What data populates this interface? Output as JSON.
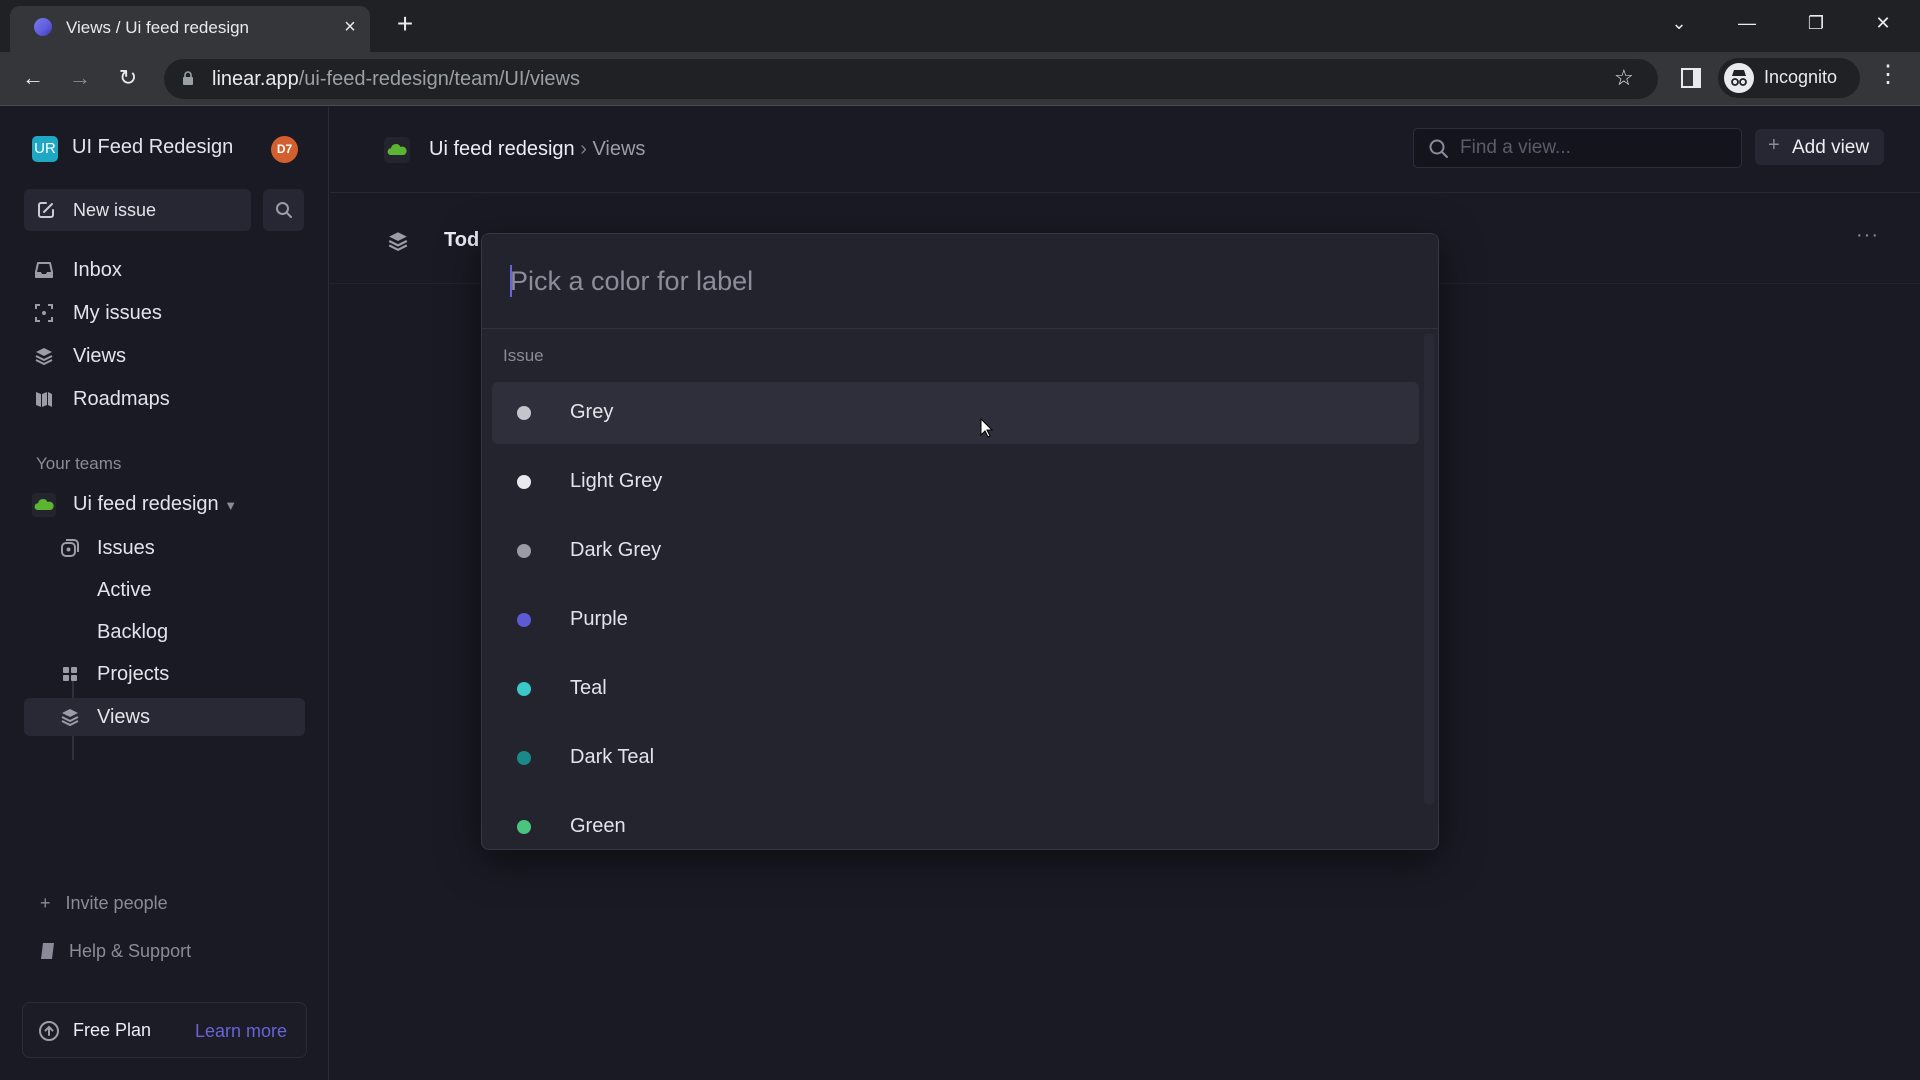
{
  "browser": {
    "tab_title": "Views / Ui feed redesign",
    "tab_close": "×",
    "new_tab": "+",
    "url_host": "linear.app",
    "url_path": "/ui-feed-redesign/team/UI/views",
    "profile_label": "Incognito",
    "window_controls": {
      "tab_search": "⌄",
      "minimize": "—",
      "maximize": "❐",
      "close": "✕"
    },
    "nav": {
      "back": "←",
      "forward": "→",
      "reload": "↻"
    },
    "star": "☆",
    "menu": "⋮"
  },
  "sidebar": {
    "workspace_initials": "UR",
    "workspace_name": "UI Feed Redesign",
    "avatar_initials": "D7",
    "new_issue_label": "New issue",
    "nav_items": [
      {
        "label": "Inbox",
        "icon": "inbox-icon"
      },
      {
        "label": "My issues",
        "icon": "my-issues-icon"
      },
      {
        "label": "Views",
        "icon": "views-icon"
      },
      {
        "label": "Roadmaps",
        "icon": "roadmaps-icon"
      }
    ],
    "teams_heading": "Your teams",
    "team": {
      "name": "Ui feed redesign",
      "caret": "▼",
      "items": [
        {
          "label": "Issues",
          "icon": "issues-icon"
        },
        {
          "label": "Active"
        },
        {
          "label": "Backlog"
        },
        {
          "label": "Projects",
          "icon": "projects-icon"
        },
        {
          "label": "Views",
          "icon": "views-icon",
          "active": true
        }
      ]
    },
    "invite_label": "Invite people",
    "invite_icon": "+",
    "help_label": "Help & Support",
    "plan_label": "Free Plan",
    "learn_more_label": "Learn more"
  },
  "header": {
    "breadcrumb_team": "Ui feed redesign",
    "breadcrumb_sep": " › ",
    "breadcrumb_page": "Views",
    "search_placeholder": "Find a view...",
    "add_view_plus": "+",
    "add_view_label": "Add view"
  },
  "view_row": {
    "name": "Tod",
    "more": "···"
  },
  "color_picker": {
    "placeholder": "Pick a color for label",
    "section_label": "Issue",
    "options": [
      {
        "name": "Grey",
        "color": "#c4c5cc",
        "highlighted": true
      },
      {
        "name": "Light Grey",
        "color": "#e8e9ef"
      },
      {
        "name": "Dark Grey",
        "color": "#9a9ba6"
      },
      {
        "name": "Purple",
        "color": "#5e5ad6"
      },
      {
        "name": "Teal",
        "color": "#3ac8c8"
      },
      {
        "name": "Dark Teal",
        "color": "#1a8a88"
      },
      {
        "name": "Green",
        "color": "#4cc47e"
      }
    ]
  },
  "colors": {
    "accent": "#6a62d8",
    "team_green": "#5bb531",
    "avatar": "#d35f2e",
    "workspace_logo": "#1ea8c4"
  }
}
